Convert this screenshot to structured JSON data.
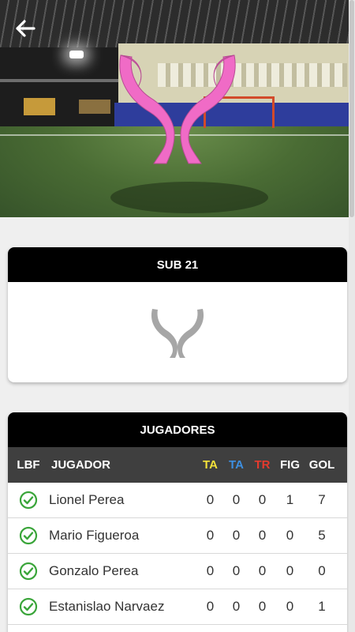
{
  "header": {
    "back_icon": "arrow-left-icon"
  },
  "hero": {
    "logo_icon": "pink-trophy-logo",
    "accent": "#f06bc6"
  },
  "category": {
    "title": "SUB 21",
    "icon": "gray-trophy-icon"
  },
  "players": {
    "title": "JUGADORES",
    "columns": {
      "lbf": "LBF",
      "player": "JUGADOR",
      "ta_yellow": "TA",
      "ta_blue": "TA",
      "tr": "TR",
      "fig": "FIG",
      "gol": "GOL"
    },
    "column_colors": {
      "ta_yellow": "#f5e23a",
      "ta_blue": "#3d8fe0",
      "tr": "#e53a2e"
    },
    "check_color": "#3aa53a",
    "rows": [
      {
        "name": "Lionel Perea",
        "ta_yellow": "0",
        "ta_blue": "0",
        "tr": "0",
        "fig": "1",
        "gol": "7"
      },
      {
        "name": "Mario Figueroa",
        "ta_yellow": "0",
        "ta_blue": "0",
        "tr": "0",
        "fig": "0",
        "gol": "5"
      },
      {
        "name": "Gonzalo Perea",
        "ta_yellow": "0",
        "ta_blue": "0",
        "tr": "0",
        "fig": "0",
        "gol": "0"
      },
      {
        "name": "Estanislao Narvaez",
        "ta_yellow": "0",
        "ta_blue": "0",
        "tr": "0",
        "fig": "0",
        "gol": "1"
      }
    ]
  }
}
